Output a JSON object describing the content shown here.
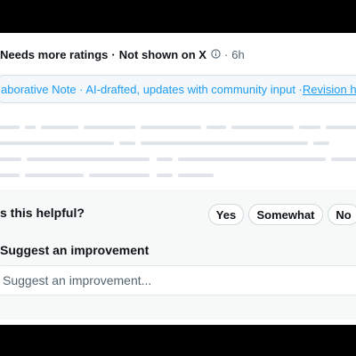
{
  "note": {
    "status_label": "Needs more ratings",
    "visibility": "Not shown on X",
    "age": "6h",
    "info_icon": "info-circle-icon"
  },
  "banner": {
    "text": "aborative Note · AI-drafted, updates with community input · ",
    "link": "Revision h"
  },
  "rating": {
    "question": "s this helpful?",
    "options": [
      "Yes",
      "Somewhat",
      "No"
    ]
  },
  "improvement": {
    "title": "Suggest an improvement",
    "placeholder": "Suggest an improvement..."
  },
  "colors": {
    "accent": "#1d9bf0",
    "placeholder_line": "#dfe5ea",
    "section_bg": "#f7f9f9"
  }
}
